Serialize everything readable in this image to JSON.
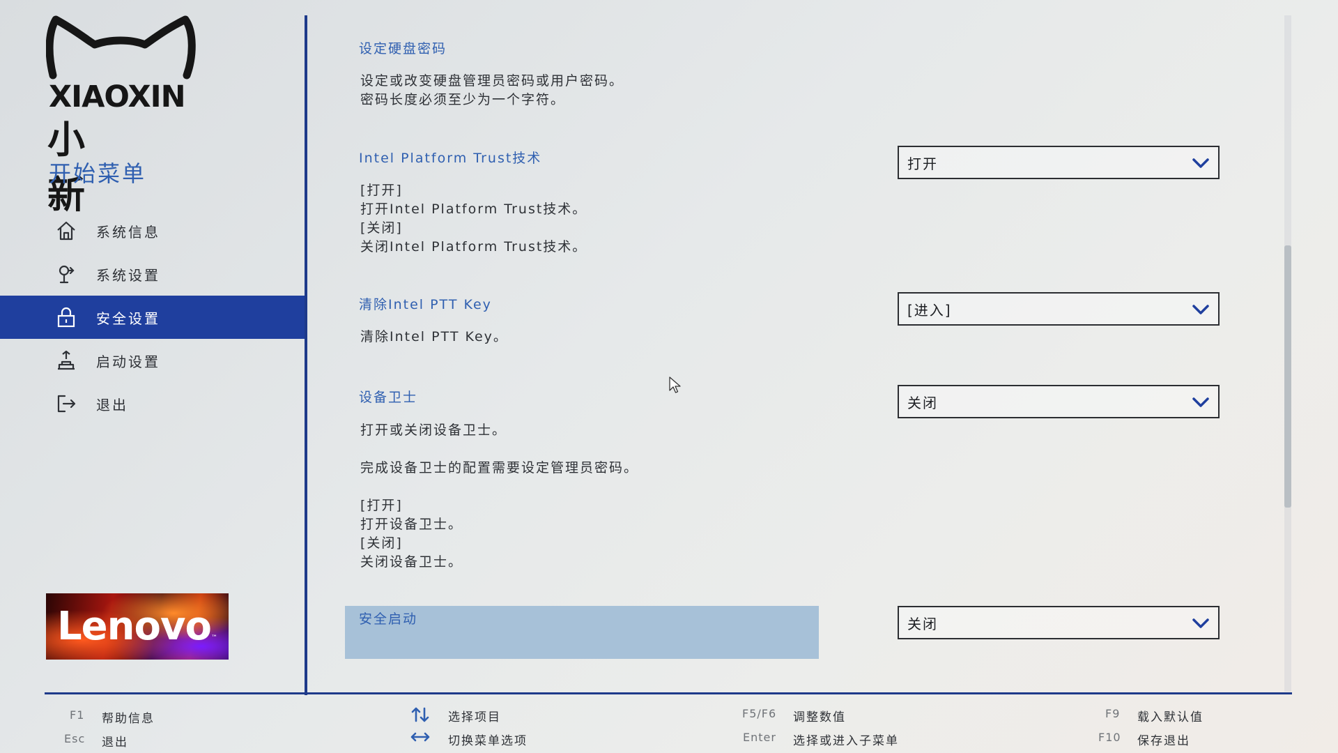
{
  "brand": {
    "logo_text": "XIAOXIN",
    "logo_cn": "小新",
    "menu_title": "开始菜单",
    "lenovo_logo": "Lenovo"
  },
  "nav": {
    "items": [
      {
        "label": "系统信息",
        "icon": "home-icon"
      },
      {
        "label": "系统设置",
        "icon": "system-settings-icon"
      },
      {
        "label": "安全设置",
        "icon": "lock-icon",
        "active": true
      },
      {
        "label": "启动设置",
        "icon": "boot-icon"
      },
      {
        "label": "退出",
        "icon": "exit-icon"
      }
    ]
  },
  "settings": {
    "hdd_password": {
      "title": "设定硬盘密码",
      "desc": "设定或改变硬盘管理员密码或用户密码。\n密码长度必须至少为一个字符。"
    },
    "ptt": {
      "title": "Intel Platform Trust技术",
      "desc": "[打开]\n打开Intel Platform Trust技术。\n[关闭]\n关闭Intel Platform Trust技术。",
      "value": "打开"
    },
    "ptt_key": {
      "title": "清除Intel PTT Key",
      "desc": "清除Intel PTT Key。",
      "value": "[进入]"
    },
    "device_guard": {
      "title": "设备卫士",
      "desc": "打开或关闭设备卫士。\n\n完成设备卫士的配置需要设定管理员密码。\n\n[打开]\n打开设备卫士。\n[关闭]\n关闭设备卫士。",
      "value": "关闭"
    },
    "secure_boot": {
      "title": "安全启动",
      "value": "关闭"
    }
  },
  "footer": {
    "f1_key": "F1",
    "f1_label": "帮助信息",
    "esc_key": "Esc",
    "esc_label": "退出",
    "updown_label": "选择项目",
    "leftright_label": "切换菜单选项",
    "f5f6_key": "F5/F6",
    "f5f6_label": "调整数值",
    "enter_key": "Enter",
    "enter_label": "选择或进入子菜单",
    "f9_key": "F9",
    "f9_label": "载入默认值",
    "f10_key": "F10",
    "f10_label": "保存退出"
  },
  "colors": {
    "accent": "#1f3f9e",
    "title_blue": "#2f5fb0",
    "highlight": "#a7c1d8"
  }
}
